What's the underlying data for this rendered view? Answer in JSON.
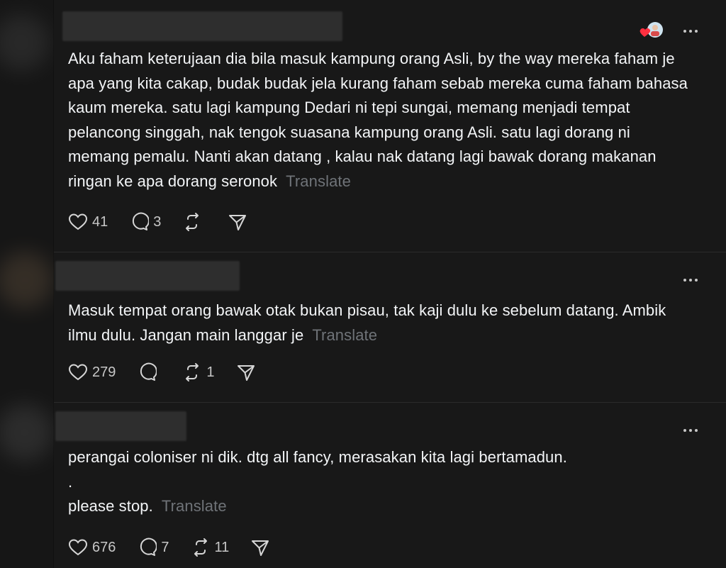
{
  "posts": [
    {
      "text": "Aku faham keterujaan dia bila masuk kampung orang Asli, by the way mereka faham je apa yang kita cakap, budak budak jela kurang faham sebab mereka cuma faham bahasa kaum mereka. satu lagi kampung Dedari ni tepi sungai, memang menjadi tempat pelancong singgah, nak tengok suasana kampung orang Asli. satu lagi dorang ni memang pemalu. Nanti akan datang , kalau nak datang lagi bawak dorang makanan ringan ke apa dorang seronok",
      "translate_label": "Translate",
      "likes": "41",
      "replies": "3",
      "reposts": ""
    },
    {
      "text": "Masuk tempat orang bawak otak bukan pisau, tak kaji dulu ke sebelum datang. Ambik ilmu dulu. Jangan main langgar je",
      "translate_label": "Translate",
      "likes": "279",
      "replies": "",
      "reposts": "1"
    },
    {
      "text": "perangai coloniser ni dik. dtg all fancy, merasakan kita lagi bertamadun.\n.\nplease stop.",
      "translate_label": "Translate",
      "likes": "676",
      "replies": "7",
      "reposts": "11"
    }
  ],
  "icons": {
    "like": "heart-icon",
    "reply": "comment-icon",
    "repost": "repost-icon",
    "share": "send-icon",
    "more": "more-options-icon"
  },
  "colors": {
    "background": "#101010",
    "card": "#181818",
    "text": "#f3f5f7",
    "muted": "#6f7378",
    "heart": "#ff3040"
  }
}
